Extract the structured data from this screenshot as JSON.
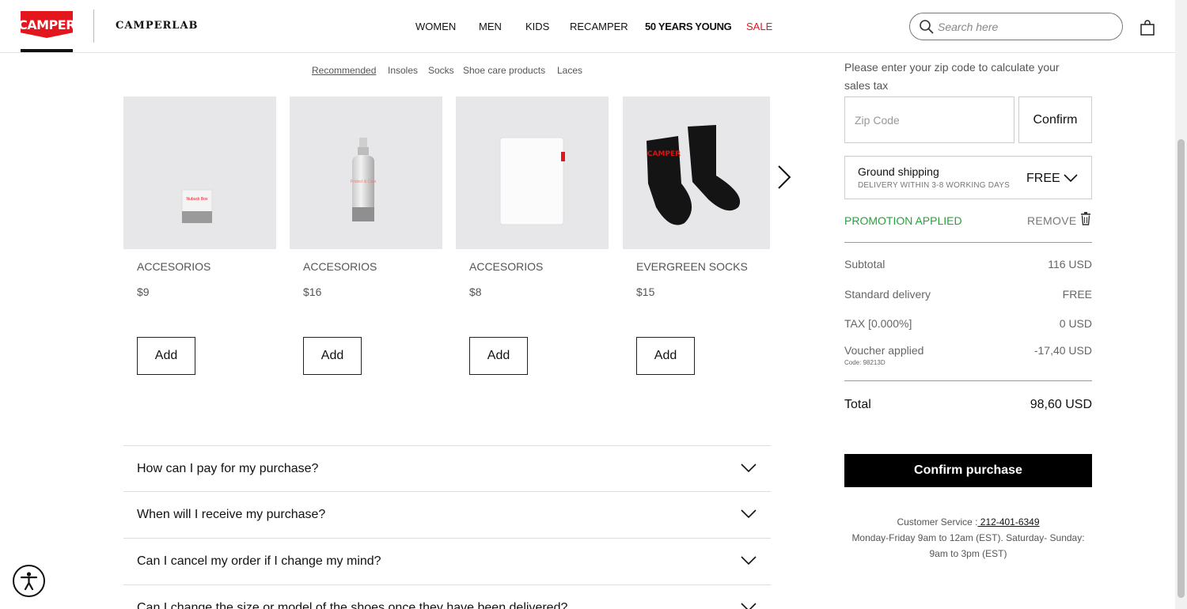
{
  "header": {
    "logo": "CAMPER",
    "sublogo": "CAMPERLAB",
    "nav": [
      {
        "label": "WOMEN"
      },
      {
        "label": "MEN"
      },
      {
        "label": "KIDS"
      },
      {
        "label": "RECAMPER"
      },
      {
        "label": "50 YEARS YOUNG"
      },
      {
        "label": "SALE"
      }
    ],
    "search_placeholder": "Search here"
  },
  "category_tabs": [
    "Recommended",
    "Insoles",
    "Socks",
    "Shoe care products",
    "Laces"
  ],
  "products": [
    {
      "name": "ACCESORIOS",
      "price": "$9",
      "add_label": "Add",
      "box_text": "Nubuck Box"
    },
    {
      "name": "ACCESORIOS",
      "price": "$16",
      "add_label": "Add",
      "bottle_text": "Protect & Care"
    },
    {
      "name": "ACCESORIOS",
      "price": "$8",
      "add_label": "Add"
    },
    {
      "name": "EVERGREEN SOCKS",
      "price": "$15",
      "add_label": "Add",
      "sock_text": "CAMPER"
    }
  ],
  "faq": [
    "How can I pay for my purchase?",
    "When will I receive my purchase?",
    "Can I cancel my order if I change my mind?",
    "Can I change the size or model of the shoes once they have been delivered?"
  ],
  "sidebar": {
    "zip_note": "Please enter your zip code to calculate your sales tax",
    "zip_placeholder": "Zip Code",
    "zip_confirm": "Confirm",
    "shipping_title": "Ground shipping",
    "shipping_sub": "DELIVERY WITHIN 3-8 WORKING DAYS",
    "shipping_price": "FREE",
    "promo": "PROMOTION APPLIED",
    "remove": "REMOVE",
    "subtotal_label": "Subtotal",
    "subtotal_value": "116 USD",
    "delivery_label": "Standard delivery",
    "delivery_value": "FREE",
    "tax_label": "TAX [0.000%]",
    "tax_value": "0 USD",
    "voucher_label": "Voucher applied",
    "voucher_value": "-17,40 USD",
    "voucher_code": "Code: 98213D",
    "total_label": "Total",
    "total_value": "98,60 USD",
    "confirm_purchase": "Confirm purchase",
    "cs_label": "Customer Service :",
    "cs_phone": " 212-401-6349",
    "cs_hours": "Monday-Friday 9am to 12am (EST). Saturday- Sunday: 9am to 3pm (EST)"
  },
  "colors": {
    "brand_red": "#e3161d",
    "promo_green": "#27a33b",
    "image_bg": "#e7e7e9"
  }
}
